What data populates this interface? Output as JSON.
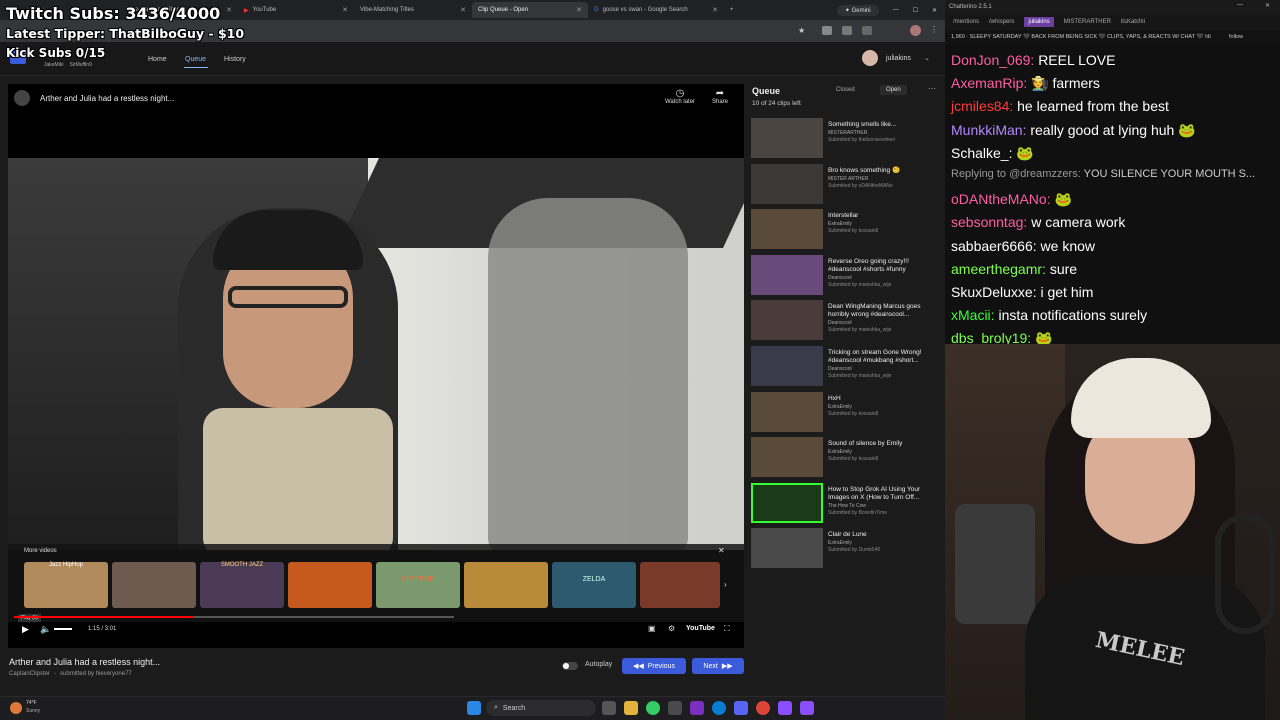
{
  "overlay": {
    "subs": "Twitch Subs: 3436/4000",
    "tipper": "Latest Tipper: ThatBilboGuy - $10",
    "kick": "Kick Subs 0/15"
  },
  "browser": {
    "tabs": [
      {
        "label": "Vibe-Matching Titles"
      },
      {
        "label": "YouTube"
      },
      {
        "label": "Vibe-Matching Titles"
      },
      {
        "label": "Clip Queue - Open"
      },
      {
        "label": "goose vs swan - Google Search"
      }
    ],
    "gemini_label": "Gemini"
  },
  "site": {
    "owners": [
      "JakeMiki",
      "SirMuffin9"
    ],
    "nav": {
      "home": "Home",
      "queue": "Queue",
      "history": "History"
    },
    "username": "juliakins"
  },
  "player": {
    "title": "Arther and Julia had a restless night...",
    "watch_later": "Watch later",
    "share": "Share",
    "more_videos": "More videos",
    "thumb_labels": [
      "Jazz HipHop",
      "",
      "SMOOTH JAZZ",
      "",
      "CITY POP",
      "",
      "ZELDA",
      ""
    ],
    "play_tooltip": "Play (k)",
    "time": "1:15 / 3:01",
    "progress": 0.41,
    "brand": "YouTube"
  },
  "below": {
    "title": "Arther and Julia had a restless night...",
    "meta_channel": "CaptainClipster",
    "meta_submitted": "submitted by hieveryone77",
    "autoplay": "Autoplay",
    "previous": "Previous",
    "next": "Next"
  },
  "queue": {
    "title": "Queue",
    "closed": "Closed",
    "open": "Open",
    "count": "10 of 24 clips left",
    "items": [
      {
        "title": "Something smells like...",
        "channel": "MISTERARTHER",
        "sub": "Submitted by thelicenseedneri"
      },
      {
        "title": "Bro knows something 🤨",
        "channel": "MISTER ARTHER",
        "sub": "Submitted by oDANtheMANo"
      },
      {
        "title": "Interstellar",
        "channel": "ExtraEmily",
        "sub": "Submitted by kossain8"
      },
      {
        "title": "Reverse Oreo going crazy!!! #deanscool #shorts #funny",
        "channel": "Deanscool",
        "sub": "Submitted by manishka_wije"
      },
      {
        "title": "Dean WingManing Marcus goes horribly wrong #deanscool...",
        "channel": "Deanscool",
        "sub": "Submitted by manishka_wije"
      },
      {
        "title": "Tricking on stream Gone Wrong! #deanscool #mukbang #short...",
        "channel": "Deanscool",
        "sub": "Submitted by manishka_wije"
      },
      {
        "title": "HxH",
        "channel": "ExtraEmily",
        "sub": "Submitted by kossain8"
      },
      {
        "title": "Sound of silence by Emily",
        "channel": "ExtraEmily",
        "sub": "Submitted by kossain8"
      },
      {
        "title": "How to Stop Grok AI Using Your Images on X (How to Turn Off...",
        "channel": "The How To Cow",
        "sub": "Submitted by BoredInTime"
      },
      {
        "title": "Clair de Lune",
        "channel": "ExtraEmily",
        "sub": "Submitted by Dumb546"
      }
    ]
  },
  "chat": {
    "app_title": "Chatterino 2.5.1",
    "tabs": [
      "/mentions",
      "/whispers",
      "juliakins",
      "MISTERARTHER",
      "itsKatchii"
    ],
    "banner": "1,960 · SLEEPY SATURDAY 🖤 BACK FROM BEING SICK 🖤 CLIPS, YAPS, & REACTS W/ CHAT 🖤 !di",
    "follow": "follow",
    "messages": [
      {
        "user": "DonJon_069:",
        "text": "REEL LOVE",
        "color": "#ff5fa2"
      },
      {
        "user": "AxemanRip:",
        "text": "🧑‍🌾 farmers",
        "color": "#ff5fa2"
      },
      {
        "user": "jcmiles84:",
        "text": "he learned from the best",
        "color": "#ff3b3b"
      },
      {
        "user": "MunkkiMan:",
        "text": "really good at lying huh 🐸",
        "color": "#b388ff"
      },
      {
        "user": "Schalke_:",
        "text": "🐸",
        "color": "#ffffff"
      },
      {
        "user": "Replying to @dreamzzers:",
        "text": "YOU SILENCE YOUR MOUTH S...",
        "color": "#999999"
      },
      {
        "user": "oDANtheMANo:",
        "text": "🐸",
        "color": "#ff5fa2"
      },
      {
        "user": "sebsonntag:",
        "text": "w camera work",
        "color": "#ff5fa2"
      },
      {
        "user": "sabbaer6666:",
        "text": "we know",
        "color": "#ffffff"
      },
      {
        "user": "ameerthegamr:",
        "text": "sure",
        "color": "#7cff4f"
      },
      {
        "user": "SkuxDeluxxe:",
        "text": "i get him",
        "color": "#ffffff"
      },
      {
        "user": "xMacii:",
        "text": "insta notifications surely",
        "color": "#3cff3c"
      },
      {
        "user": "dbs_broly19:",
        "text": "🐸",
        "color": "#7cff4f"
      }
    ]
  },
  "webcam": {
    "shirt_text": "MELEE"
  },
  "taskbar": {
    "weather_temp": "74°F",
    "weather_text": "Sunny",
    "search": "Search"
  }
}
